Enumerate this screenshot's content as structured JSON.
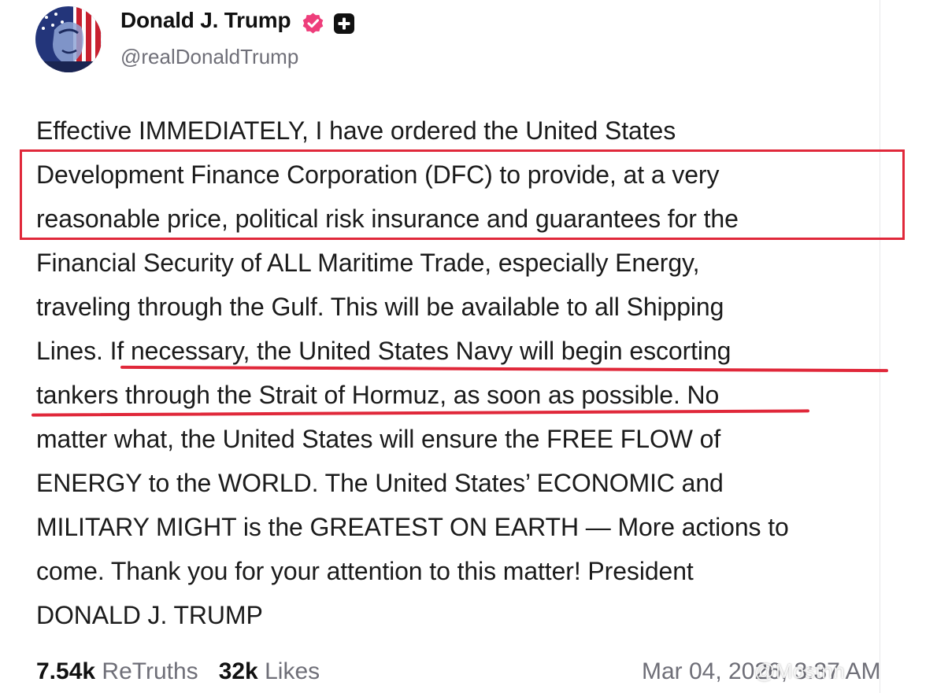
{
  "author": {
    "display_name": "Donald J. Trump",
    "handle": "@realDonaldTrump",
    "avatar_icon": "avatar-flag-portrait",
    "verified_icon": "verified-badge-icon",
    "badge_icon": "plus-badge-icon"
  },
  "post": {
    "lines": [
      "Effective IMMEDIATELY, I have ordered the United States",
      "Development Finance Corporation (DFC) to provide, at a very",
      "reasonable price, political risk insurance and guarantees for the",
      "Financial Security of ALL Maritime Trade, especially Energy,",
      "traveling through the Gulf. This will be available to all Shipping",
      "Lines. If necessary, the United States Navy will begin escorting",
      "tankers through the Strait of Hormuz, as soon as possible. No",
      "matter what, the United States will ensure the FREE FLOW of",
      "ENERGY to the WORLD. The United States’ ECONOMIC and",
      "MILITARY MIGHT is the GREATEST ON EARTH — More actions to",
      "come. Thank you for your attention to this matter! President",
      "DONALD J. TRUMP"
    ]
  },
  "stats": {
    "retruths_count": "7.54k",
    "retruths_label": "ReTruths",
    "likes_count": "32k",
    "likes_label": "Likes"
  },
  "timestamp": "Mar 04, 2026, 3:37 AM",
  "watermark": "@Mostnn",
  "colors": {
    "annotation_red": "#e0283a",
    "verified_pink": "#ee3e7b",
    "muted_text": "#6f6f78"
  }
}
